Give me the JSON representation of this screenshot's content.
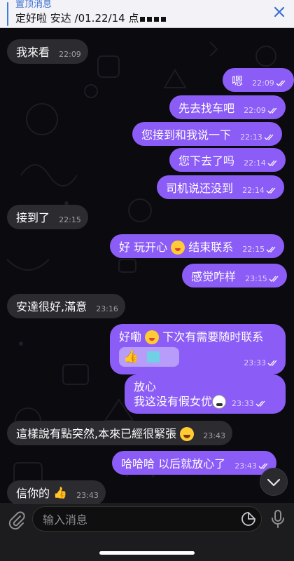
{
  "pinned": {
    "title": "置顶消息",
    "text": "定好啦 安达 /01.22/14 点"
  },
  "messages": [
    {
      "dir": "in",
      "text": "我來看",
      "time": "22:09"
    },
    {
      "dir": "out",
      "text": "嗯",
      "time": "22:09"
    },
    {
      "dir": "out",
      "text": "先去找车吧",
      "time": "22:09"
    },
    {
      "dir": "out",
      "text": "您接到和我说一下",
      "time": "22:13"
    },
    {
      "dir": "out",
      "text": "您下去了吗",
      "time": "22:14"
    },
    {
      "dir": "out",
      "text": "司机说还没到",
      "time": "22:14"
    },
    {
      "dir": "in",
      "text": "接到了",
      "time": "22:15"
    },
    {
      "dir": "out",
      "text_a": "好 玩开心",
      "text_b": "结束联系",
      "time": "22:15"
    },
    {
      "dir": "out",
      "text": "感觉咋样",
      "time": "23:15"
    },
    {
      "dir": "in",
      "text": "安達很好,滿意",
      "time": "23:16"
    },
    {
      "dir": "out",
      "text_a": "好嘞",
      "text_b": "下次有需要随时联系",
      "time": "23:33"
    },
    {
      "dir": "out",
      "line1": "放心",
      "line2": "我这没有假女优",
      "time": "23:33"
    },
    {
      "dir": "in",
      "text": "這樣說有點突然,本來已經很緊張",
      "time": "23:43"
    },
    {
      "dir": "out",
      "text": "哈哈哈 以后就放心了",
      "time": "23:43"
    },
    {
      "dir": "in",
      "text": "信你的",
      "time": "23:43"
    }
  ],
  "input": {
    "placeholder": "输入消息"
  },
  "icons": {
    "close": "close-icon",
    "attach": "paperclip-icon",
    "sticker": "sticker-icon",
    "mic": "microphone-icon",
    "scroll": "chevron-down-icon",
    "read": "double-check-icon"
  },
  "colors": {
    "outgoing_bubble": "#8b5cf6",
    "incoming_bubble": "#2b2b30",
    "accent": "#3b6fd0"
  }
}
